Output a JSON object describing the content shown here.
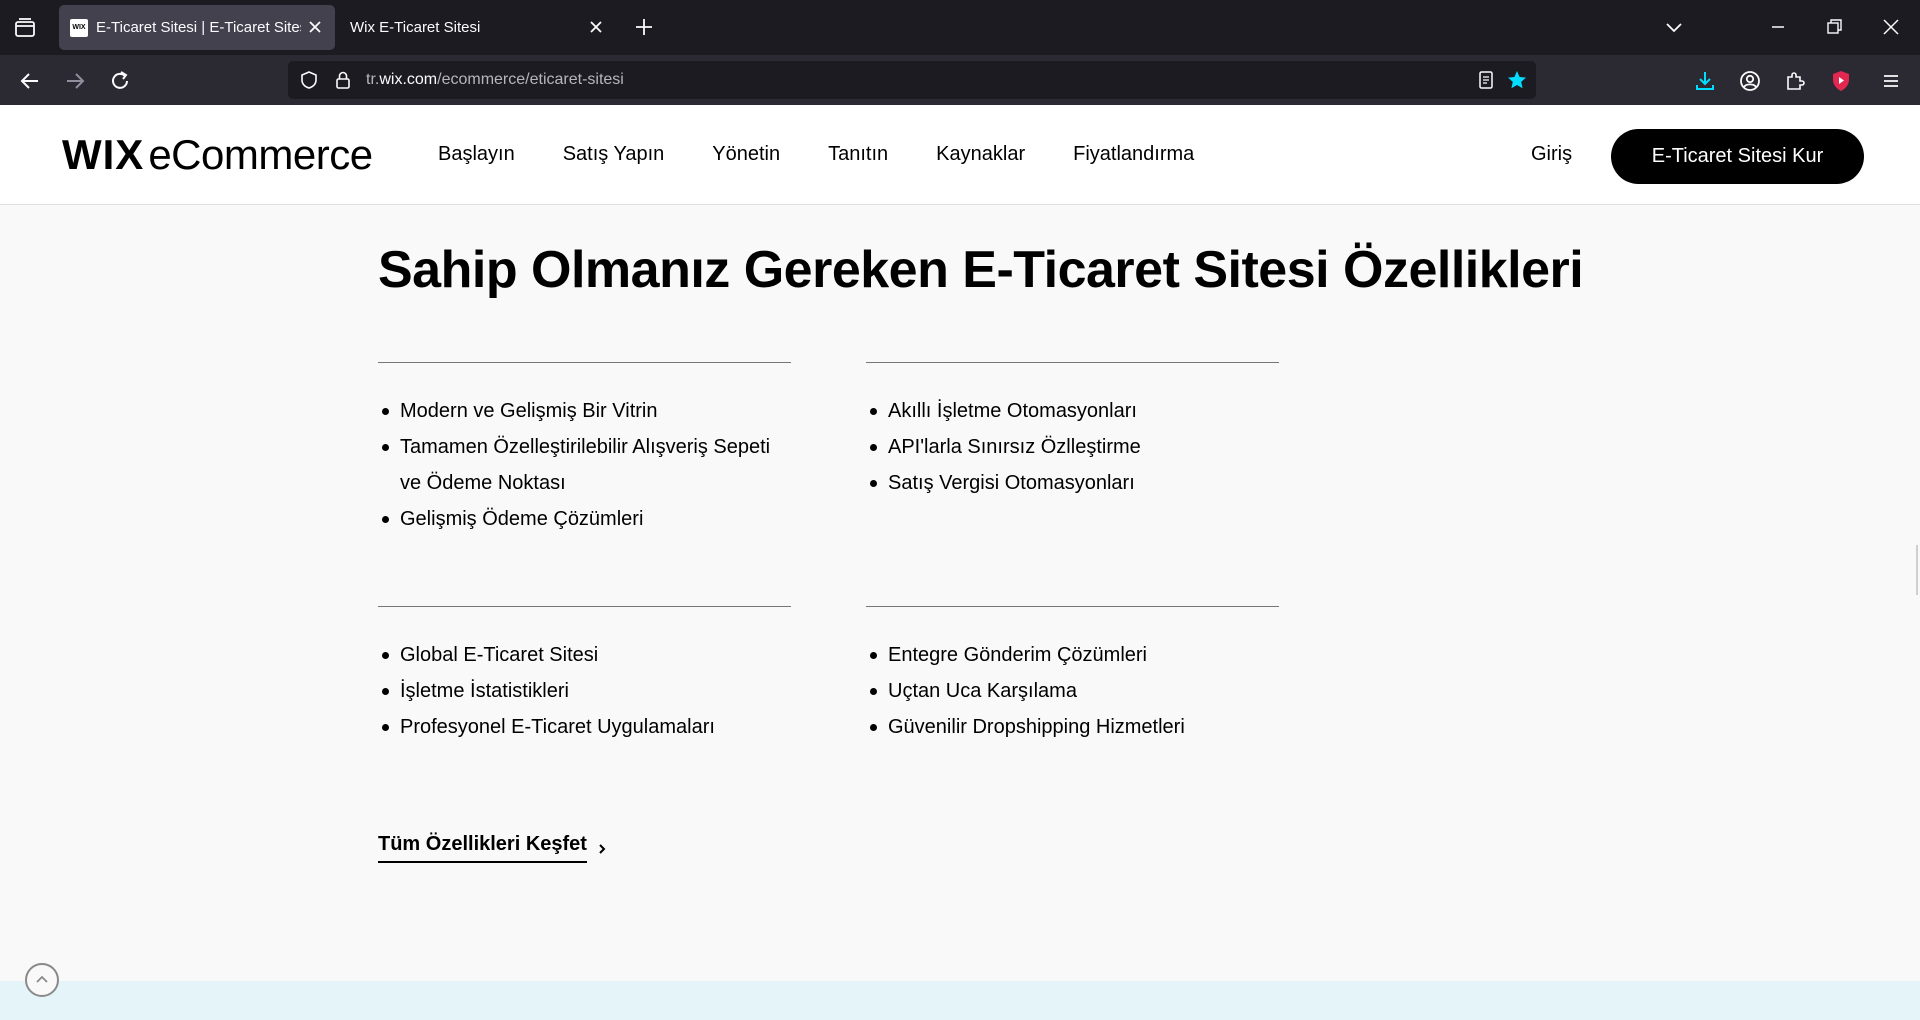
{
  "browser": {
    "tabs": [
      {
        "title": "E-Ticaret Sitesi | E-Ticaret Sitesi",
        "favicon_text": "WIX",
        "active": true
      },
      {
        "title": "Wix E-Ticaret Sitesi",
        "active": false
      }
    ],
    "url_prefix": "tr.",
    "url_host": "wix.com",
    "url_path": "/ecommerce/eticaret-sitesi"
  },
  "header": {
    "logo_wix": "WIX",
    "logo_suffix": "eCommerce",
    "menu": [
      "Başlayın",
      "Satış Yapın",
      "Yönetin",
      "Tanıtın",
      "Kaynaklar",
      "Fiyatlandırma"
    ],
    "login": "Giriş",
    "cta": "E-Ticaret Sitesi Kur"
  },
  "main": {
    "heading": "Sahip Olmanız Gereken E-Ticaret Sitesi Özellikleri",
    "groups": [
      {
        "items": [
          "Modern ve Gelişmiş Bir Vitrin",
          "Tamamen Özelleştirilebilir Alışveriş Sepeti ve Ödeme Noktası",
          "Gelişmiş Ödeme Çözümleri"
        ]
      },
      {
        "items": [
          "Akıllı İşletme Otomasyonları",
          "API'larla Sınırsız Özlleştirme",
          "Satış Vergisi Otomasyonları"
        ]
      },
      {
        "items": [
          "Global E-Ticaret Sitesi",
          "İşletme İstatistikleri",
          "Profesyonel E-Ticaret Uygulamaları"
        ]
      },
      {
        "items": [
          "Entegre Gönderim Çözümleri",
          "Uçtan Uca Karşılama",
          "Güvenilir Dropshipping Hizmetleri"
        ]
      }
    ],
    "explore_link": "Tüm Özellikleri Keşfet"
  },
  "colors": {
    "chrome_dark": "#1c1b22",
    "toolbar": "#2b2a33",
    "page_bg": "#f9f9f9",
    "cta_bg": "#000000",
    "bottom_band": "#e5f4f8",
    "bookmark_star": "#00ddff",
    "download_icon": "#00ddff",
    "extension_red": "#e22850"
  },
  "icons": [
    "tab-list-icon",
    "close-icon",
    "plus-icon",
    "chevron-down-icon",
    "minimize-icon",
    "restore-icon",
    "back-arrow-icon",
    "forward-arrow-icon",
    "reload-icon",
    "shield-icon",
    "lock-icon",
    "reader-view-icon",
    "star-icon",
    "download-icon",
    "account-icon",
    "extensions-icon",
    "youtube-ext-icon",
    "hamburger-menu-icon",
    "chevron-right-icon",
    "scroll-top-icon"
  ]
}
